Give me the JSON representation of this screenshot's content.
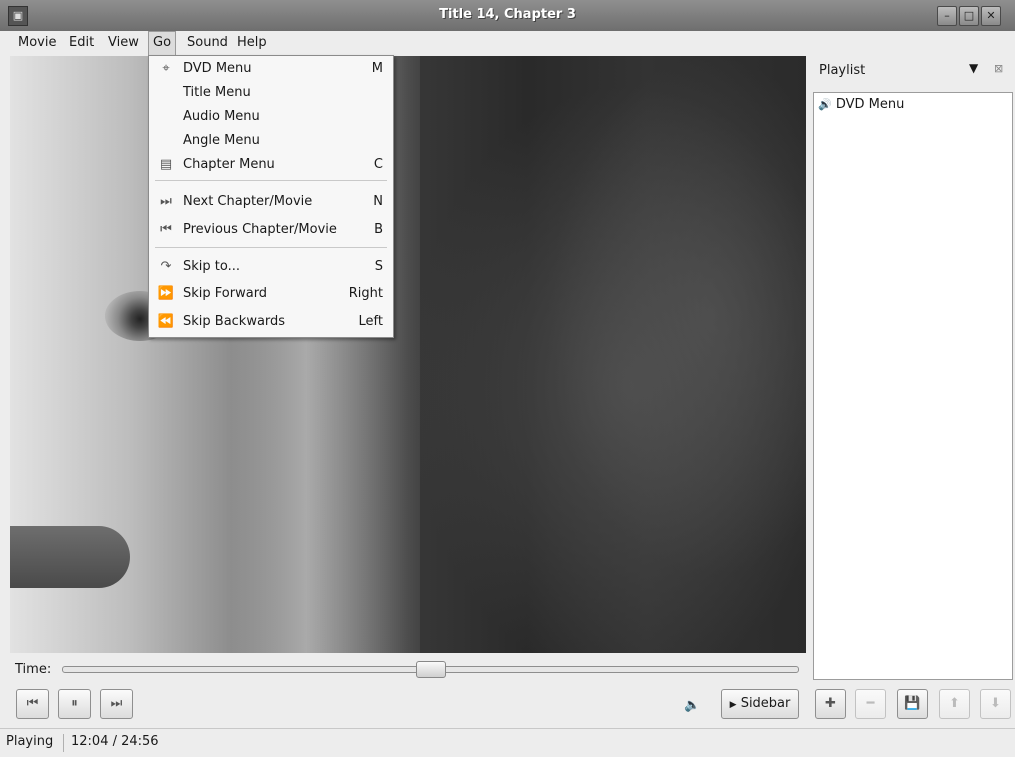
{
  "window": {
    "title": "Title 14, Chapter 3"
  },
  "menubar": {
    "items": [
      {
        "label": "Movie"
      },
      {
        "label": "Edit"
      },
      {
        "label": "View"
      },
      {
        "label": "Go"
      },
      {
        "label": "Sound"
      },
      {
        "label": "Help"
      }
    ]
  },
  "go_menu": {
    "items": [
      {
        "label": "DVD Menu",
        "accel": "M",
        "icon": "dvd-menu-icon"
      },
      {
        "label": "Title Menu",
        "accel": ""
      },
      {
        "label": "Audio Menu",
        "accel": ""
      },
      {
        "label": "Angle Menu",
        "accel": ""
      },
      {
        "label": "Chapter Menu",
        "accel": "C",
        "icon": "chapter-menu-icon"
      },
      {
        "label": "Next Chapter/Movie",
        "accel": "N",
        "icon": "next-chapter-icon"
      },
      {
        "label": "Previous Chapter/Movie",
        "accel": "B",
        "icon": "previous-chapter-icon"
      },
      {
        "label": "Skip to...",
        "accel": "S",
        "icon": "skip-to-icon"
      },
      {
        "label": "Skip Forward",
        "accel": "Right",
        "icon": "skip-forward-icon"
      },
      {
        "label": "Skip Backwards",
        "accel": "Left",
        "icon": "skip-backwards-icon"
      }
    ]
  },
  "sidebar": {
    "title": "Playlist",
    "playlist": [
      {
        "label": "DVD Menu",
        "icon": "speaker-icon"
      }
    ]
  },
  "controls": {
    "time_label": "Time:",
    "seek_fraction": 0.5,
    "sidebar_button": "Sidebar"
  },
  "status": {
    "state": "Playing",
    "time": "12:04 / 24:56"
  }
}
